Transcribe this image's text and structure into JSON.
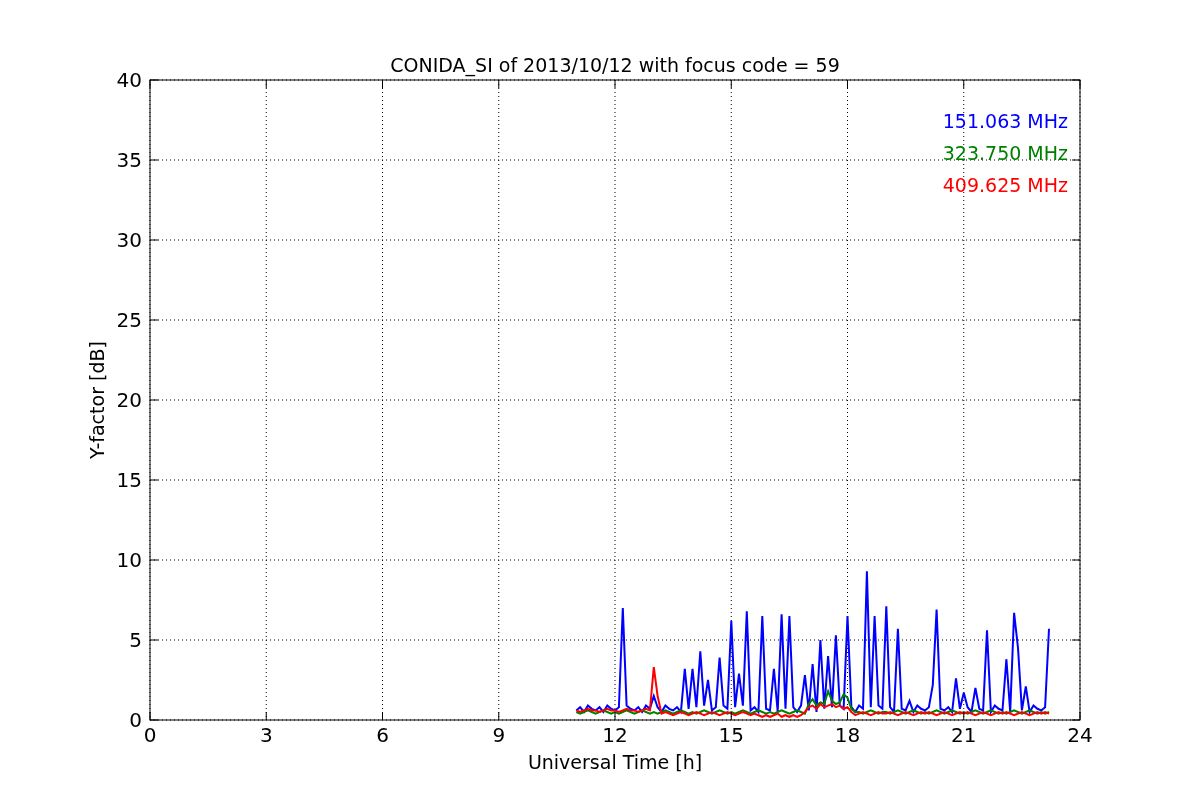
{
  "chart_data": {
    "type": "line",
    "title": "CONIDA_SI of 2013/10/12 with focus code = 59",
    "xlabel": "Universal Time [h]",
    "ylabel": "Y-factor [dB]",
    "xlim": [
      0,
      24
    ],
    "ylim": [
      0,
      40
    ],
    "xticks": [
      0,
      3,
      6,
      9,
      12,
      15,
      18,
      21,
      24
    ],
    "yticks": [
      0,
      5,
      10,
      15,
      20,
      25,
      30,
      35,
      40
    ],
    "grid": true,
    "x": [
      11,
      11.1,
      11.2,
      11.3,
      11.4,
      11.5,
      11.6,
      11.7,
      11.8,
      11.9,
      12,
      12.1,
      12.2,
      12.3,
      12.4,
      12.5,
      12.6,
      12.7,
      12.8,
      12.9,
      13,
      13.1,
      13.2,
      13.3,
      13.4,
      13.5,
      13.6,
      13.7,
      13.8,
      13.9,
      14,
      14.1,
      14.2,
      14.3,
      14.4,
      14.5,
      14.6,
      14.7,
      14.8,
      14.9,
      15,
      15.1,
      15.2,
      15.3,
      15.4,
      15.5,
      15.6,
      15.7,
      15.8,
      15.9,
      16,
      16.1,
      16.2,
      16.3,
      16.4,
      16.5,
      16.6,
      16.7,
      16.8,
      16.9,
      17,
      17.1,
      17.2,
      17.3,
      17.4,
      17.5,
      17.6,
      17.7,
      17.8,
      17.9,
      18,
      18.1,
      18.2,
      18.3,
      18.4,
      18.5,
      18.6,
      18.7,
      18.8,
      18.9,
      19,
      19.1,
      19.2,
      19.3,
      19.4,
      19.5,
      19.6,
      19.7,
      19.8,
      19.9,
      20,
      20.1,
      20.2,
      20.3,
      20.4,
      20.5,
      20.6,
      20.7,
      20.8,
      20.9,
      21,
      21.1,
      21.2,
      21.3,
      21.4,
      21.5,
      21.6,
      21.7,
      21.8,
      21.9,
      22,
      22.1,
      22.2,
      22.3,
      22.4,
      22.5,
      22.6,
      22.7,
      22.8,
      22.9,
      23,
      23.1,
      23.2
    ],
    "series": [
      {
        "name": "151.063 MHz",
        "color": "#0000ff",
        "values": [
          0.6,
          0.8,
          0.5,
          0.9,
          0.7,
          0.6,
          0.8,
          0.5,
          0.9,
          0.7,
          0.6,
          0.8,
          7.0,
          0.9,
          0.7,
          0.6,
          0.8,
          0.5,
          0.9,
          0.7,
          1.5,
          0.8,
          0.5,
          0.9,
          0.7,
          0.6,
          0.8,
          0.5,
          3.2,
          0.7,
          3.2,
          0.8,
          4.3,
          0.9,
          2.5,
          0.6,
          0.8,
          3.9,
          0.9,
          0.7,
          6.2,
          0.8,
          2.9,
          0.9,
          6.8,
          0.6,
          0.8,
          0.5,
          6.5,
          0.7,
          0.6,
          3.2,
          0.5,
          6.6,
          0.7,
          6.5,
          0.8,
          0.5,
          0.9,
          2.8,
          0.6,
          3.5,
          0.5,
          5.0,
          0.7,
          4.0,
          0.8,
          5.3,
          0.9,
          0.7,
          6.5,
          0.8,
          0.5,
          0.9,
          0.7,
          9.3,
          0.8,
          6.5,
          0.9,
          0.7,
          7.1,
          0.8,
          0.5,
          5.7,
          0.7,
          0.6,
          1.2,
          0.5,
          0.9,
          0.7,
          0.6,
          0.8,
          2.2,
          6.9,
          0.7,
          0.6,
          0.8,
          0.5,
          2.6,
          0.7,
          1.7,
          0.8,
          0.5,
          2.0,
          0.7,
          0.6,
          5.6,
          0.5,
          0.9,
          0.7,
          0.6,
          3.8,
          0.5,
          6.7,
          4.5,
          0.6,
          2.1,
          0.5,
          0.9,
          0.7,
          0.6,
          0.8,
          5.7
        ]
      },
      {
        "name": "323.750 MHz",
        "color": "#008000",
        "values": [
          0.5,
          0.4,
          0.5,
          0.6,
          0.5,
          0.4,
          0.5,
          0.6,
          0.5,
          0.4,
          0.5,
          0.4,
          0.5,
          0.6,
          0.5,
          0.4,
          0.5,
          0.6,
          0.5,
          0.4,
          0.5,
          0.4,
          0.5,
          0.6,
          0.5,
          0.4,
          0.5,
          0.6,
          0.5,
          0.4,
          0.5,
          0.4,
          0.5,
          0.6,
          0.5,
          0.4,
          0.5,
          0.6,
          0.5,
          0.4,
          0.5,
          0.4,
          0.5,
          0.6,
          0.5,
          0.4,
          0.5,
          0.6,
          0.5,
          0.4,
          0.5,
          0.4,
          0.5,
          0.6,
          0.5,
          0.4,
          0.5,
          0.6,
          0.5,
          0.4,
          1.0,
          1.3,
          0.9,
          1.1,
          1.0,
          1.8,
          1.2,
          1.0,
          1.1,
          1.6,
          1.4,
          0.7,
          0.5,
          0.5,
          0.4,
          0.5,
          0.6,
          0.5,
          0.4,
          0.5,
          0.5,
          0.4,
          0.5,
          0.6,
          0.5,
          0.4,
          0.5,
          0.6,
          0.5,
          0.4,
          0.5,
          0.4,
          0.5,
          0.6,
          0.5,
          0.4,
          0.5,
          0.6,
          0.5,
          0.4,
          0.5,
          0.4,
          0.5,
          0.6,
          0.5,
          0.4,
          0.5,
          0.6,
          0.5,
          0.4,
          0.5,
          0.4,
          0.5,
          0.6,
          0.5,
          0.4,
          0.5,
          0.6,
          0.5,
          0.4,
          0.5,
          0.4,
          0.5
        ]
      },
      {
        "name": "409.625 MHz",
        "color": "#ff0000",
        "values": [
          0.6,
          0.5,
          0.6,
          0.7,
          0.6,
          0.6,
          0.5,
          0.6,
          0.7,
          0.6,
          0.6,
          0.5,
          0.6,
          0.7,
          0.6,
          0.6,
          0.5,
          0.6,
          0.7,
          0.6,
          3.3,
          1.5,
          0.4,
          0.5,
          0.4,
          0.3,
          0.4,
          0.5,
          0.4,
          0.3,
          0.4,
          0.5,
          0.4,
          0.3,
          0.4,
          0.5,
          0.4,
          0.3,
          0.4,
          0.5,
          0.4,
          0.3,
          0.4,
          0.5,
          0.4,
          0.3,
          0.4,
          0.3,
          0.2,
          0.3,
          0.2,
          0.3,
          0.4,
          0.2,
          0.3,
          0.2,
          0.3,
          0.2,
          0.3,
          0.5,
          0.8,
          0.9,
          0.7,
          1.0,
          0.8,
          0.9,
          1.0,
          0.8,
          0.9,
          0.7,
          0.8,
          0.5,
          0.3,
          0.4,
          0.5,
          0.4,
          0.3,
          0.4,
          0.5,
          0.4,
          0.4,
          0.5,
          0.4,
          0.3,
          0.4,
          0.5,
          0.4,
          0.3,
          0.4,
          0.5,
          0.4,
          0.5,
          0.4,
          0.3,
          0.4,
          0.5,
          0.4,
          0.3,
          0.4,
          0.5,
          0.4,
          0.5,
          0.4,
          0.3,
          0.4,
          0.5,
          0.4,
          0.3,
          0.4,
          0.5,
          0.4,
          0.5,
          0.4,
          0.3,
          0.4,
          0.5,
          0.4,
          0.3,
          0.4,
          0.5,
          0.4,
          0.5,
          0.4
        ]
      }
    ]
  }
}
